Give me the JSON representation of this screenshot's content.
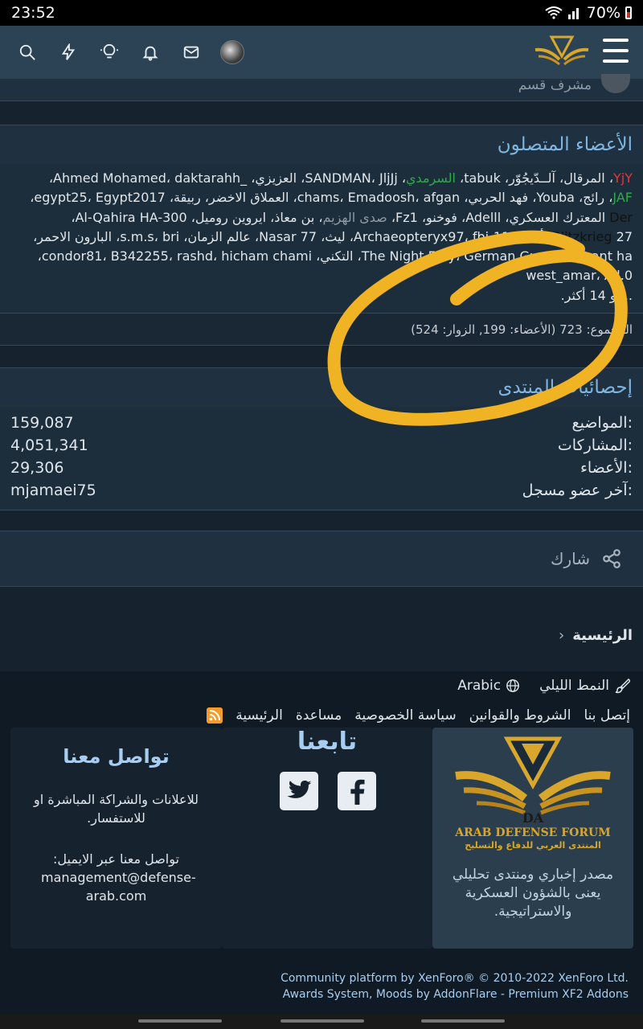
{
  "status_bar": {
    "time": "23:52",
    "battery": "70%"
  },
  "nav": {
    "icons": [
      "search-icon",
      "bolt-icon",
      "bulb-icon",
      "bell-icon",
      "mail-icon"
    ]
  },
  "moderator_strip": {
    "text": "مشرف قسم"
  },
  "online": {
    "title": "الأعضاء المتصلون",
    "lines": [
      [
        {
          "t": "YjY",
          "c": "red"
        },
        {
          "t": "، المرقال، آلــدّيجُوّر، tabuk، "
        },
        {
          "t": "السرمدي",
          "c": "green"
        },
        {
          "t": "، SANDMAN، JljJj، العزيزي، _Ahmed Mohamed، daktarahh،"
        }
      ],
      [
        {
          "t": "JAF",
          "c": "green"
        },
        {
          "t": "، رائج، Youba، فهد الحربي، chams، Emadoosh، afgan، العملاق الاخضر، ربيقة، egypt25، Egypt2017،"
        }
      ],
      [
        {
          "t": "Der",
          "c": "dark"
        },
        {
          "t": " المعترك العسكري، Adelll، فوخنو، Fz1، "
        },
        {
          "t": "صدى الهزيم",
          "c": "gray"
        },
        {
          "t": "، بن معاذ، ايروين روميل، Al-Qahira HA-300،"
        }
      ],
      [
        {
          "t": "Blitzkrieg",
          "c": "dark"
        },
        {
          "t": " 27، أحْمَدَ، Archaeopteryx97، fbi-11، ليث، Nasar 77، عالم الزمان، s.m.s، bri، البارون الاحمر،"
        }
      ],
      [
        {
          "t": "The Night Fury، German Gun، Sergeant ha، التكني، condor81، B342255، rashd، hicham chami،"
        }
      ],
      [
        {
          "t": "west_amar، All.0"
        }
      ],
      [
        {
          "t": "... و 14 أكثر."
        }
      ]
    ],
    "footer": "المجموع: 723 (الأعضاء: 199, الزوار: 524)"
  },
  "stats": {
    "title": "إحصائيات المنتدى",
    "rows": [
      {
        "label": "المواضيع:",
        "value": "159,087"
      },
      {
        "label": "المشاركات:",
        "value": "4,051,341"
      },
      {
        "label": "الأعضاء:",
        "value": "29,306"
      },
      {
        "label": "آخر عضو مسجل:",
        "value": "mjamaei75"
      }
    ]
  },
  "share": {
    "label": "شارك"
  },
  "breadcrumb": {
    "home": "الرئيسية"
  },
  "footer": {
    "night_mode": "النمط الليلي",
    "language": "Arabic",
    "links": [
      "إتصل بنا",
      "الشروط والقوانين",
      "سياسة الخصوصية",
      "مساعدة",
      "الرئيسية"
    ],
    "about": {
      "logo_text": "ARAB DEFENSE FORUM",
      "logo_sub": "المنتدى العربي للدفاع والتسليح",
      "logo_mark": "DA",
      "text": "مصدر إخباري ومنتدى تحليلي يعنى بالشؤون العسكرية والاستراتيجية."
    },
    "follow": {
      "title": "تابعنا"
    },
    "contact": {
      "title": "تواصل معنا",
      "p1": "للاعلانات والشراكة المباشرة او للاستفسار.",
      "p2": "تواصل معنا عبر الايميل:",
      "email": "management@defense-arab.com"
    },
    "copyright1": "Community platform by XenForo® © 2010-2022 XenForo Ltd.",
    "copyright2": "Awards System, Moods by AddonFlare - Premium XF2 Addons"
  }
}
